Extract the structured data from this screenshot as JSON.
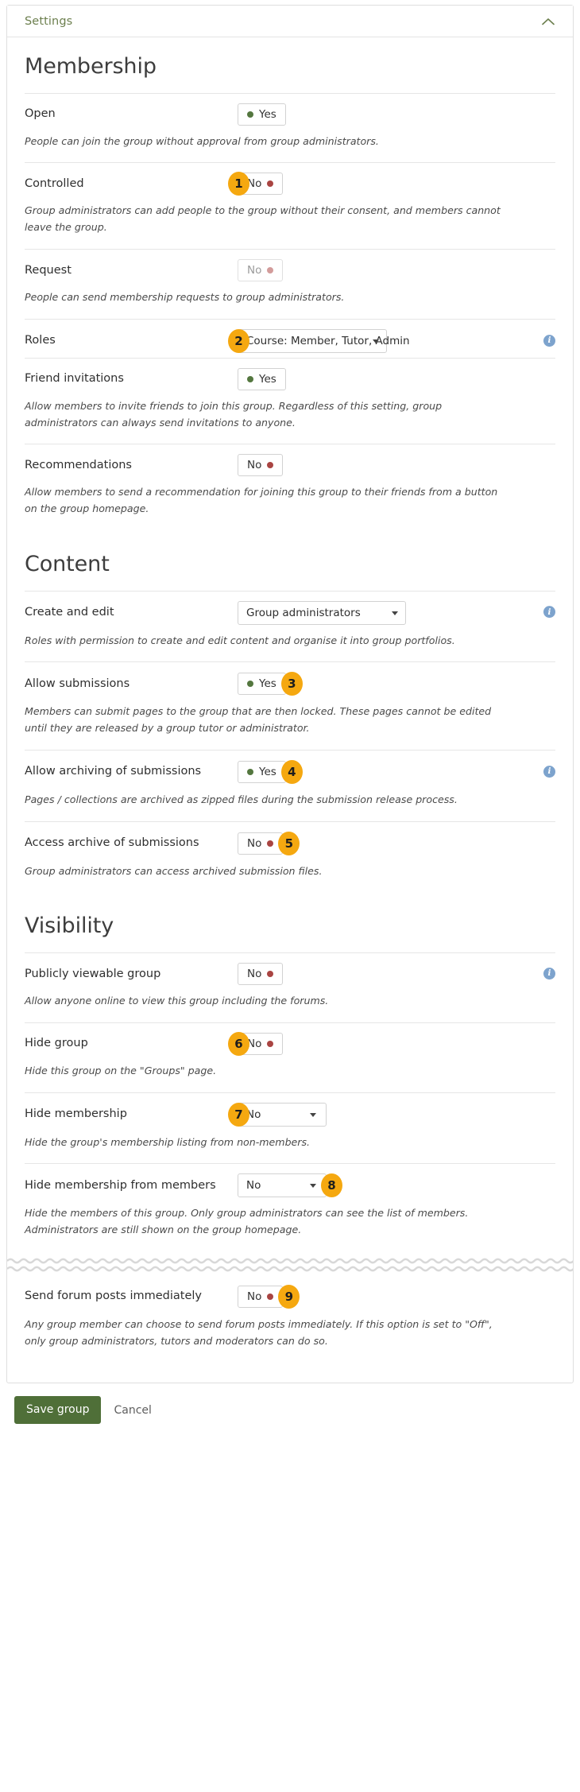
{
  "panel": {
    "title": "Settings",
    "collapse_icon": "chevron-up-icon"
  },
  "colors": {
    "accent_green": "#6c7f4e",
    "badge_orange": "#f5a810",
    "on_dot": "#54773f",
    "off_dot": "#a94442",
    "info_blue": "#7da3cd",
    "save_button": "#4f6f38"
  },
  "sections": [
    {
      "heading": "Membership",
      "fields": [
        {
          "label": "Open",
          "control": "switch",
          "value": "Yes",
          "state": "on",
          "disabled": false,
          "help": "People can join the group without approval from group administrators.",
          "info": false,
          "badge": null,
          "badge_side": null
        },
        {
          "label": "Controlled",
          "control": "switch",
          "value": "No",
          "state": "off",
          "disabled": false,
          "help": "Group administrators can add people to the group without their consent, and members cannot leave the group.",
          "info": false,
          "badge": "1",
          "badge_side": "left"
        },
        {
          "label": "Request",
          "control": "switch",
          "value": "No",
          "state": "off",
          "disabled": true,
          "help": "People can send membership requests to group administrators.",
          "info": false,
          "badge": null,
          "badge_side": null
        },
        {
          "label": "Roles",
          "control": "select",
          "value": "Course: Member, Tutor, Admin",
          "width": "w-roles",
          "help": null,
          "info": true,
          "badge": "2",
          "badge_side": "left"
        },
        {
          "label": "Friend invitations",
          "control": "switch",
          "value": "Yes",
          "state": "on",
          "disabled": false,
          "help": "Allow members to invite friends to join this group. Regardless of this setting, group administrators can always send invitations to anyone.",
          "info": false,
          "badge": null,
          "badge_side": null
        },
        {
          "label": "Recommendations",
          "control": "switch",
          "value": "No",
          "state": "off",
          "disabled": false,
          "help": "Allow members to send a recommendation for joining this group to their friends from a button on the group homepage.",
          "info": false,
          "badge": null,
          "badge_side": null
        }
      ]
    },
    {
      "heading": "Content",
      "fields": [
        {
          "label": "Create and edit",
          "control": "select",
          "value": "Group administrators",
          "width": "w-create",
          "help": "Roles with permission to create and edit content and organise it into group portfolios.",
          "info": true,
          "badge": null,
          "badge_side": null
        },
        {
          "label": "Allow submissions",
          "control": "switch",
          "value": "Yes",
          "state": "on",
          "disabled": false,
          "help": "Members can submit pages to the group that are then locked. These pages cannot be edited until they are released by a group tutor or administrator.",
          "info": false,
          "badge": "3",
          "badge_side": "right"
        },
        {
          "label": "Allow archiving of submissions",
          "control": "switch",
          "value": "Yes",
          "state": "on",
          "disabled": false,
          "help": "Pages / collections are archived as zipped files during the submission release process.",
          "info": true,
          "badge": "4",
          "badge_side": "right"
        },
        {
          "label": "Access archive of submissions",
          "control": "switch",
          "value": "No",
          "state": "off",
          "disabled": false,
          "help": "Group administrators can access archived submission files.",
          "info": false,
          "badge": "5",
          "badge_side": "right"
        }
      ]
    },
    {
      "heading": "Visibility",
      "fields": [
        {
          "label": "Publicly viewable group",
          "control": "switch",
          "value": "No",
          "state": "off",
          "disabled": false,
          "help": "Allow anyone online to view this group including the forums.",
          "info": true,
          "badge": null,
          "badge_side": null
        },
        {
          "label": "Hide group",
          "control": "switch",
          "value": "No",
          "state": "off",
          "disabled": false,
          "help": "Hide this group on the \"Groups\" page.",
          "info": false,
          "badge": "6",
          "badge_side": "left"
        },
        {
          "label": "Hide membership",
          "control": "select",
          "value": "No",
          "width": "w-hide",
          "help": "Hide the group's membership listing from non-members.",
          "info": false,
          "badge": "7",
          "badge_side": "left"
        },
        {
          "label": "Hide membership from members",
          "control": "select",
          "value": "No",
          "width": "w-hide",
          "help": "Hide the members of this group. Only group administrators can see the list of members. Administrators are still shown on the group homepage.",
          "info": false,
          "badge": "8",
          "badge_side": "right",
          "torn_after": true
        },
        {
          "label": "Send forum posts immediately",
          "control": "switch",
          "value": "No",
          "state": "off",
          "disabled": false,
          "help": "Any group member can choose to send forum posts immediately. If this option is set to \"Off\", only group administrators, tutors and moderators can do so.",
          "info": false,
          "badge": "9",
          "badge_side": "right",
          "no_rule": true
        }
      ]
    }
  ],
  "footer": {
    "save_label": "Save group",
    "cancel_label": "Cancel"
  }
}
